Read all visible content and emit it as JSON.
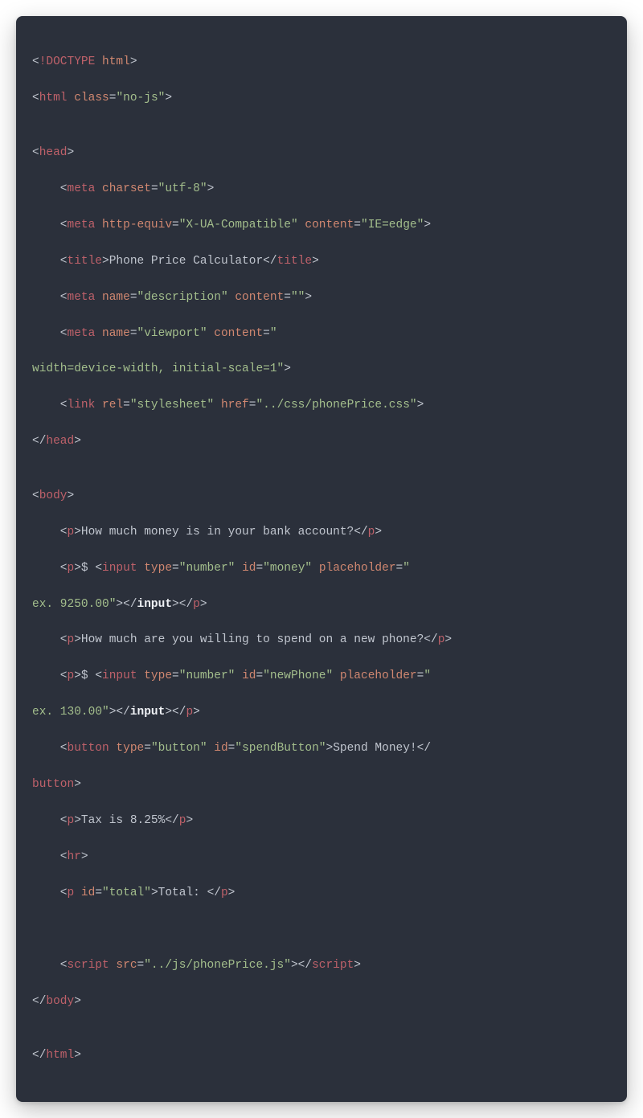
{
  "lines": {
    "l1": {
      "open": "<",
      "doctype": "!DOCTYPE",
      "sp": " ",
      "html": "html",
      "close": ">"
    },
    "l2": {
      "open": "<",
      "tag": "html",
      "sp": " ",
      "attr": "class",
      "eq": "=",
      "val": "\"no-js\"",
      "close": ">"
    },
    "l3": "",
    "l4": {
      "open": "<",
      "tag": "head",
      "close": ">"
    },
    "l5": {
      "open": "<",
      "tag": "meta",
      "sp": " ",
      "a1": "charset",
      "eq": "=",
      "v1": "\"utf-8\"",
      "close": ">"
    },
    "l6": {
      "open": "<",
      "tag": "meta",
      "sp": " ",
      "a1": "http-equiv",
      "eq1": "=",
      "v1": "\"X-UA-Compatible\"",
      "sp2": " ",
      "a2": "content",
      "eq2": "=",
      "v2": "\"IE=edge\"",
      "close": ">"
    },
    "l7": {
      "open": "<",
      "tag": "title",
      "close": ">",
      "txt": "Phone Price Calculator",
      "open2": "</",
      "tag2": "title",
      "close2": ">"
    },
    "l8": {
      "open": "<",
      "tag": "meta",
      "sp": " ",
      "a1": "name",
      "eq1": "=",
      "v1": "\"description\"",
      "sp2": " ",
      "a2": "content",
      "eq2": "=",
      "v2": "\"\"",
      "close": ">"
    },
    "l9a": {
      "open": "<",
      "tag": "meta",
      "sp": " ",
      "a1": "name",
      "eq1": "=",
      "v1": "\"viewport\"",
      "sp2": " ",
      "a2": "content",
      "eq2": "=",
      "v2a": "\""
    },
    "l9b": {
      "v2b": "width=device-width, initial-scale=1\"",
      "close": ">"
    },
    "l10": {
      "open": "<",
      "tag": "link",
      "sp": " ",
      "a1": "rel",
      "eq1": "=",
      "v1": "\"stylesheet\"",
      "sp2": " ",
      "a2": "href",
      "eq2": "=",
      "v2": "\"../css/phonePrice.css\"",
      "close": ">"
    },
    "l11": {
      "open": "</",
      "tag": "head",
      "close": ">"
    },
    "l12": "",
    "l13": {
      "open": "<",
      "tag": "body",
      "close": ">"
    },
    "l14": {
      "open": "<",
      "tag": "p",
      "close": ">",
      "txt": "How much money is in your bank account?",
      "open2": "</",
      "tag2": "p",
      "close2": ">"
    },
    "l15a": {
      "open": "<",
      "tag": "p",
      "close": ">",
      "pretxt": "$ ",
      "open2": "<",
      "tag2": "input",
      "sp": " ",
      "a1": "type",
      "eq1": "=",
      "v1": "\"number\"",
      "sp2": " ",
      "a2": "id",
      "eq2": "=",
      "v2": "\"money\"",
      "sp3": " ",
      "a3": "placeholder",
      "eq3": "=",
      "v3a": "\""
    },
    "l15b": {
      "v3b": "ex. 9250.00\"",
      "close": ">",
      "open3": "</",
      "tag3": "input",
      "close3": ">",
      "open4": "</",
      "tag4": "p",
      "close4": ">"
    },
    "l16": {
      "open": "<",
      "tag": "p",
      "close": ">",
      "txt": "How much are you willing to spend on a new phone?",
      "open2": "</",
      "tag2": "p",
      "close2": ">"
    },
    "l17a": {
      "open": "<",
      "tag": "p",
      "close": ">",
      "pretxt": "$ ",
      "open2": "<",
      "tag2": "input",
      "sp": " ",
      "a1": "type",
      "eq1": "=",
      "v1": "\"number\"",
      "sp2": " ",
      "a2": "id",
      "eq2": "=",
      "v2": "\"newPhone\"",
      "sp3": " ",
      "a3": "placeholder",
      "eq3": "=",
      "v3a": "\""
    },
    "l17b": {
      "v3b": "ex. 130.00\"",
      "close": ">",
      "open3": "</",
      "tag3": "input",
      "close3": ">",
      "open4": "</",
      "tag4": "p",
      "close4": ">"
    },
    "l18a": {
      "open": "<",
      "tag": "button",
      "sp": " ",
      "a1": "type",
      "eq1": "=",
      "v1": "\"button\"",
      "sp2": " ",
      "a2": "id",
      "eq2": "=",
      "v2": "\"spendButton\"",
      "close": ">",
      "txt": "Spend Money!",
      "open2": "</"
    },
    "l18b": {
      "tag2": "button",
      "close2": ">"
    },
    "l19": {
      "open": "<",
      "tag": "p",
      "close": ">",
      "txt": "Tax is 8.25%",
      "open2": "</",
      "tag2": "p",
      "close2": ">"
    },
    "l20": {
      "open": "<",
      "tag": "hr",
      "close": ">"
    },
    "l21": {
      "open": "<",
      "tag": "p",
      "sp": " ",
      "a1": "id",
      "eq1": "=",
      "v1": "\"total\"",
      "close": ">",
      "txt": "Total: ",
      "open2": "</",
      "tag2": "p",
      "close2": ">"
    },
    "l22": "",
    "l23": "",
    "l24": {
      "open": "<",
      "tag": "script",
      "sp": " ",
      "a1": "src",
      "eq1": "=",
      "v1": "\"../js/phonePrice.js\"",
      "close": ">",
      "open2": "</",
      "tag2": "script",
      "close2": ">"
    },
    "l25": {
      "open": "</",
      "tag": "body",
      "close": ">"
    },
    "l26": "",
    "l27": {
      "open": "</",
      "tag": "html",
      "close": ">"
    }
  }
}
